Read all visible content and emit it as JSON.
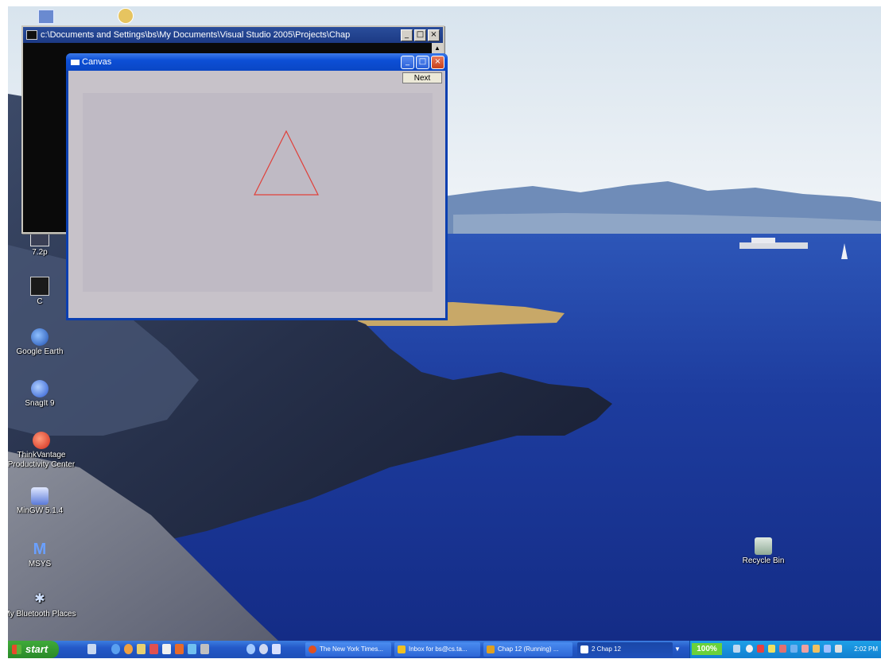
{
  "console_window": {
    "title": "c:\\Documents and Settings\\bs\\My Documents\\Visual Studio 2005\\Projects\\Chap",
    "buttons": [
      "_",
      "□",
      "×"
    ]
  },
  "canvas_window": {
    "title": "Canvas",
    "next_label": "Next",
    "buttons": [
      "_",
      "□",
      "×"
    ],
    "triangle_color": "#e0403a"
  },
  "desktop_icons": [
    {
      "label": "7.2p",
      "icon": "folder-icon"
    },
    {
      "label": "C",
      "icon": "console-shortcut-icon"
    },
    {
      "label": "Google Earth",
      "icon": "google-earth-icon"
    },
    {
      "label": "SnagIt 9",
      "icon": "snagit-icon"
    },
    {
      "label": "ThinkVantage Productivity Center",
      "icon": "thinkvantage-icon"
    },
    {
      "label": "MinGW 5.1.4",
      "icon": "mingw-icon"
    },
    {
      "label": "MSYS",
      "icon": "msys-icon"
    },
    {
      "label": "My Bluetooth Places",
      "icon": "bluetooth-icon"
    },
    {
      "label": "Recycle Bin",
      "icon": "recycle-bin-icon"
    }
  ],
  "taskbar": {
    "start_label": "start",
    "tasks": [
      {
        "label": "The New York Times...",
        "icon_color": "#e05020"
      },
      {
        "label": "Inbox for bs@cs.ta...",
        "icon_color": "#f0c020"
      },
      {
        "label": "Chap 12 (Running) ...",
        "icon_color": "#e0a020"
      },
      {
        "label": "2 Chap 12",
        "icon_color": "#ffffff"
      }
    ],
    "zoom_label": "100%",
    "clock": "2:02 PM"
  },
  "colors": {
    "xp_blue": "#0c4fd6",
    "sea": "#1a3a9a",
    "start_green": "#2a8a28"
  }
}
